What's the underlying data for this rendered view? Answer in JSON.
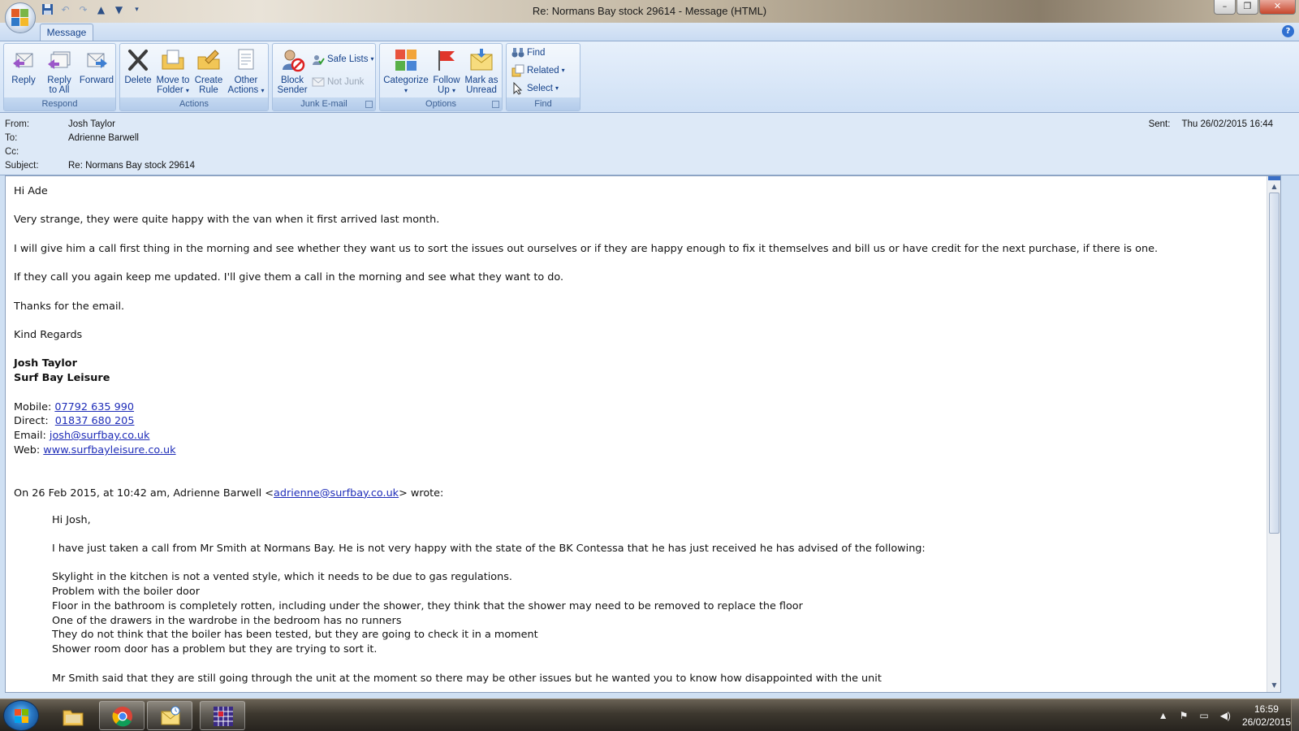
{
  "window": {
    "title": "Re: Normans Bay stock 29614 - Message (HTML)",
    "minimize": "–",
    "maximize": "❐",
    "close": "✕"
  },
  "ribbon": {
    "tab": "Message",
    "groups": {
      "respond": "Respond",
      "actions": "Actions",
      "junk": "Junk E-mail",
      "options": "Options",
      "find": "Find"
    },
    "buttons": {
      "reply": "Reply",
      "reply_all_1": "Reply",
      "reply_all_2": "to All",
      "forward": "Forward",
      "delete": "Delete",
      "move_1": "Move to",
      "move_2": "Folder",
      "create_1": "Create",
      "create_2": "Rule",
      "other_1": "Other",
      "other_2": "Actions",
      "block_1": "Block",
      "block_2": "Sender",
      "safe_lists": "Safe Lists",
      "not_junk": "Not Junk",
      "categorize": "Categorize",
      "follow_1": "Follow",
      "follow_2": "Up",
      "mark_1": "Mark as",
      "mark_2": "Unread",
      "find": "Find",
      "related": "Related",
      "select": "Select"
    }
  },
  "header": {
    "from_label": "From:",
    "from": "Josh Taylor",
    "to_label": "To:",
    "to": "Adrienne Barwell",
    "cc_label": "Cc:",
    "cc": "",
    "subject_label": "Subject:",
    "subject": "Re: Normans Bay stock 29614",
    "sent_label": "Sent:",
    "sent": "Thu 26/02/2015 16:44"
  },
  "body": {
    "greeting": "Hi Ade",
    "p1": "Very strange, they were quite happy with the van when it first arrived last month.",
    "p2": "I will give him a call first thing in the morning and see whether they want us to sort the issues out ourselves or if they are happy enough to fix it themselves and bill us or have credit for the next purchase, if there is one.",
    "p3": "If they call you again keep me updated. I'll give them a call in the morning and see what they want to do.",
    "p4": "Thanks for the email.",
    "closing": "Kind Regards",
    "sig_name": "Josh Taylor",
    "sig_company": "Surf Bay Leisure",
    "mobile_label": "Mobile: ",
    "mobile": "07792 635 990",
    "direct_label": "Direct:  ",
    "direct": "01837 680 205",
    "email_label": "Email: ",
    "email": "josh@surfbay.co.uk",
    "web_label": "Web: ",
    "web": "www.surfbayleisure.co.uk",
    "quote_intro_a": "On 26 Feb 2015, at 10:42 am, Adrienne Barwell <",
    "quote_email": "adrienne@surfbay.co.uk",
    "quote_intro_b": "> wrote:",
    "quote_greeting": "Hi Josh,",
    "quote_p1": "I have just taken a call from Mr Smith at Normans Bay.  He is not very happy with the state of the BK Contessa that he has just received he has advised of the following:",
    "issues": [
      "Skylight in the kitchen is not a vented style, which it needs to be due to gas regulations.",
      "Problem with the boiler door",
      "Floor in the bathroom is completely rotten, including under the shower, they think that the shower may need to be removed to replace the floor",
      "One of the drawers in the wardrobe in the bedroom has no runners",
      "They do not think that the boiler has been tested, but they are going to check it in a moment",
      "Shower room door has a problem but they are trying to sort it."
    ],
    "quote_p2": "Mr Smith said that they are still going through the unit at the moment so there may be other issues but he wanted you to know how disappointed with the unit"
  },
  "taskbar": {
    "time": "16:59",
    "date": "26/02/2015"
  }
}
